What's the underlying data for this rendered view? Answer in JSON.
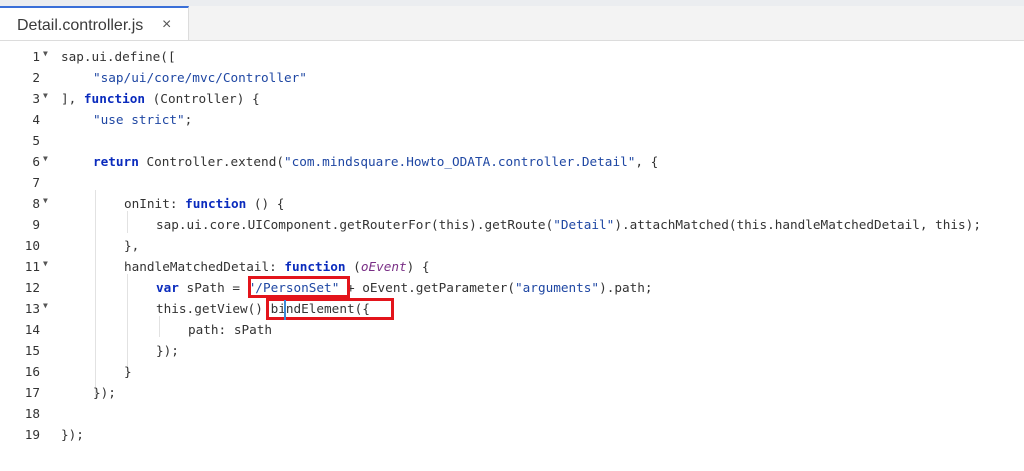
{
  "tab": {
    "label": "Detail.controller.js",
    "close": "×"
  },
  "lines": [
    {
      "n": "1",
      "fold": true
    },
    {
      "n": "2",
      "fold": false
    },
    {
      "n": "3",
      "fold": true
    },
    {
      "n": "4",
      "fold": false
    },
    {
      "n": "5",
      "fold": false
    },
    {
      "n": "6",
      "fold": true
    },
    {
      "n": "7",
      "fold": false
    },
    {
      "n": "8",
      "fold": true
    },
    {
      "n": "9",
      "fold": false
    },
    {
      "n": "10",
      "fold": false
    },
    {
      "n": "11",
      "fold": true
    },
    {
      "n": "12",
      "fold": false
    },
    {
      "n": "13",
      "fold": true
    },
    {
      "n": "14",
      "fold": false
    },
    {
      "n": "15",
      "fold": false
    },
    {
      "n": "16",
      "fold": false
    },
    {
      "n": "17",
      "fold": false
    },
    {
      "n": "18",
      "fold": false
    },
    {
      "n": "19",
      "fold": false
    }
  ],
  "code": {
    "l1": "sap.ui.define([",
    "l2_str": "\"sap/ui/core/mvc/Controller\"",
    "l3_a": "], ",
    "l3_kw": "function",
    "l3_b": " (Controller) {",
    "l4_str": "\"use strict\"",
    "l4_b": ";",
    "l6_kw": "return",
    "l6_a": " Controller.extend(",
    "l6_str": "\"com.mindsquare.Howto_ODATA.controller.Detail\"",
    "l6_b": ", {",
    "l8_a": "onInit: ",
    "l8_kw": "function",
    "l8_b": " () {",
    "l9_a": "sap.ui.core.UIComponent.getRouterFor(this).getRoute(",
    "l9_str": "\"Detail\"",
    "l9_b": ").attachMatched(this.handleMatchedDetail, this);",
    "l10": "},",
    "l11_a": "handleMatchedDetail: ",
    "l11_kw": "function",
    "l11_b": " (",
    "l11_param": "oEvent",
    "l11_c": ") {",
    "l12_kw": "var",
    "l12_a": " sPath = ",
    "l12_str": "\"/PersonSet\"",
    "l12_b": " + oEvent.getParameter(",
    "l12_str2": "\"arguments\"",
    "l12_c": ").path;",
    "l13": "this.getView().bindElement({",
    "l14": "path: sPath",
    "l15": "});",
    "l16": "}",
    "l17": "});",
    "l19": "});"
  }
}
